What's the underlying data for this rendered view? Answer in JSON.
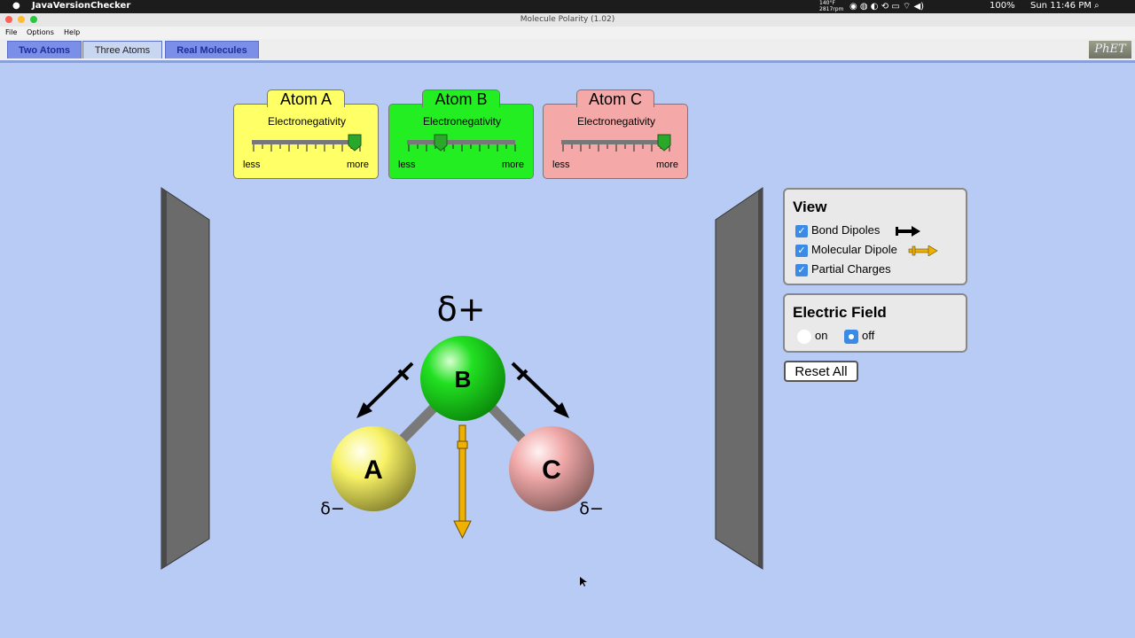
{
  "os_menubar": {
    "app_name": "JavaVersionChecker",
    "temp": "140°F",
    "rpm": "2817rpm",
    "battery": "100%",
    "clock": "Sun 11:46 PM"
  },
  "window": {
    "title": "Molecule Polarity (1.02)"
  },
  "app_menu": [
    "File",
    "Options",
    "Help"
  ],
  "tabs": [
    {
      "label": "Two Atoms",
      "selected": false
    },
    {
      "label": "Three Atoms",
      "selected": true
    },
    {
      "label": "Real Molecules",
      "selected": false
    }
  ],
  "logo": "PhET",
  "atoms": [
    {
      "title": "Atom A",
      "subtitle": "Electronegativity",
      "less": "less",
      "more": "more",
      "color": "#ffff66",
      "electronegativity_fraction": 0.95
    },
    {
      "title": "Atom B",
      "subtitle": "Electronegativity",
      "less": "less",
      "more": "more",
      "color": "#22ee22",
      "electronegativity_fraction": 0.3
    },
    {
      "title": "Atom C",
      "subtitle": "Electronegativity",
      "less": "less",
      "more": "more",
      "color": "#f5a8a8",
      "electronegativity_fraction": 0.95
    }
  ],
  "molecule": {
    "atom_labels": [
      "A",
      "B",
      "C"
    ],
    "partial_charge_top": "δ+",
    "partial_charge_left": "δ−",
    "partial_charge_right": "δ−"
  },
  "view_panel": {
    "title": "View",
    "items": [
      {
        "label": "Bond Dipoles",
        "checked": true
      },
      {
        "label": "Molecular Dipole",
        "checked": true
      },
      {
        "label": "Partial Charges",
        "checked": true
      }
    ]
  },
  "efield_panel": {
    "title": "Electric Field",
    "on_label": "on",
    "off_label": "off",
    "selected": "off"
  },
  "reset_label": "Reset All",
  "colors": {
    "background": "#b8cbf5",
    "tab_inactive": "#7b8fe8",
    "checkbox": "#3b8be6",
    "dipole": "#f0b000"
  }
}
